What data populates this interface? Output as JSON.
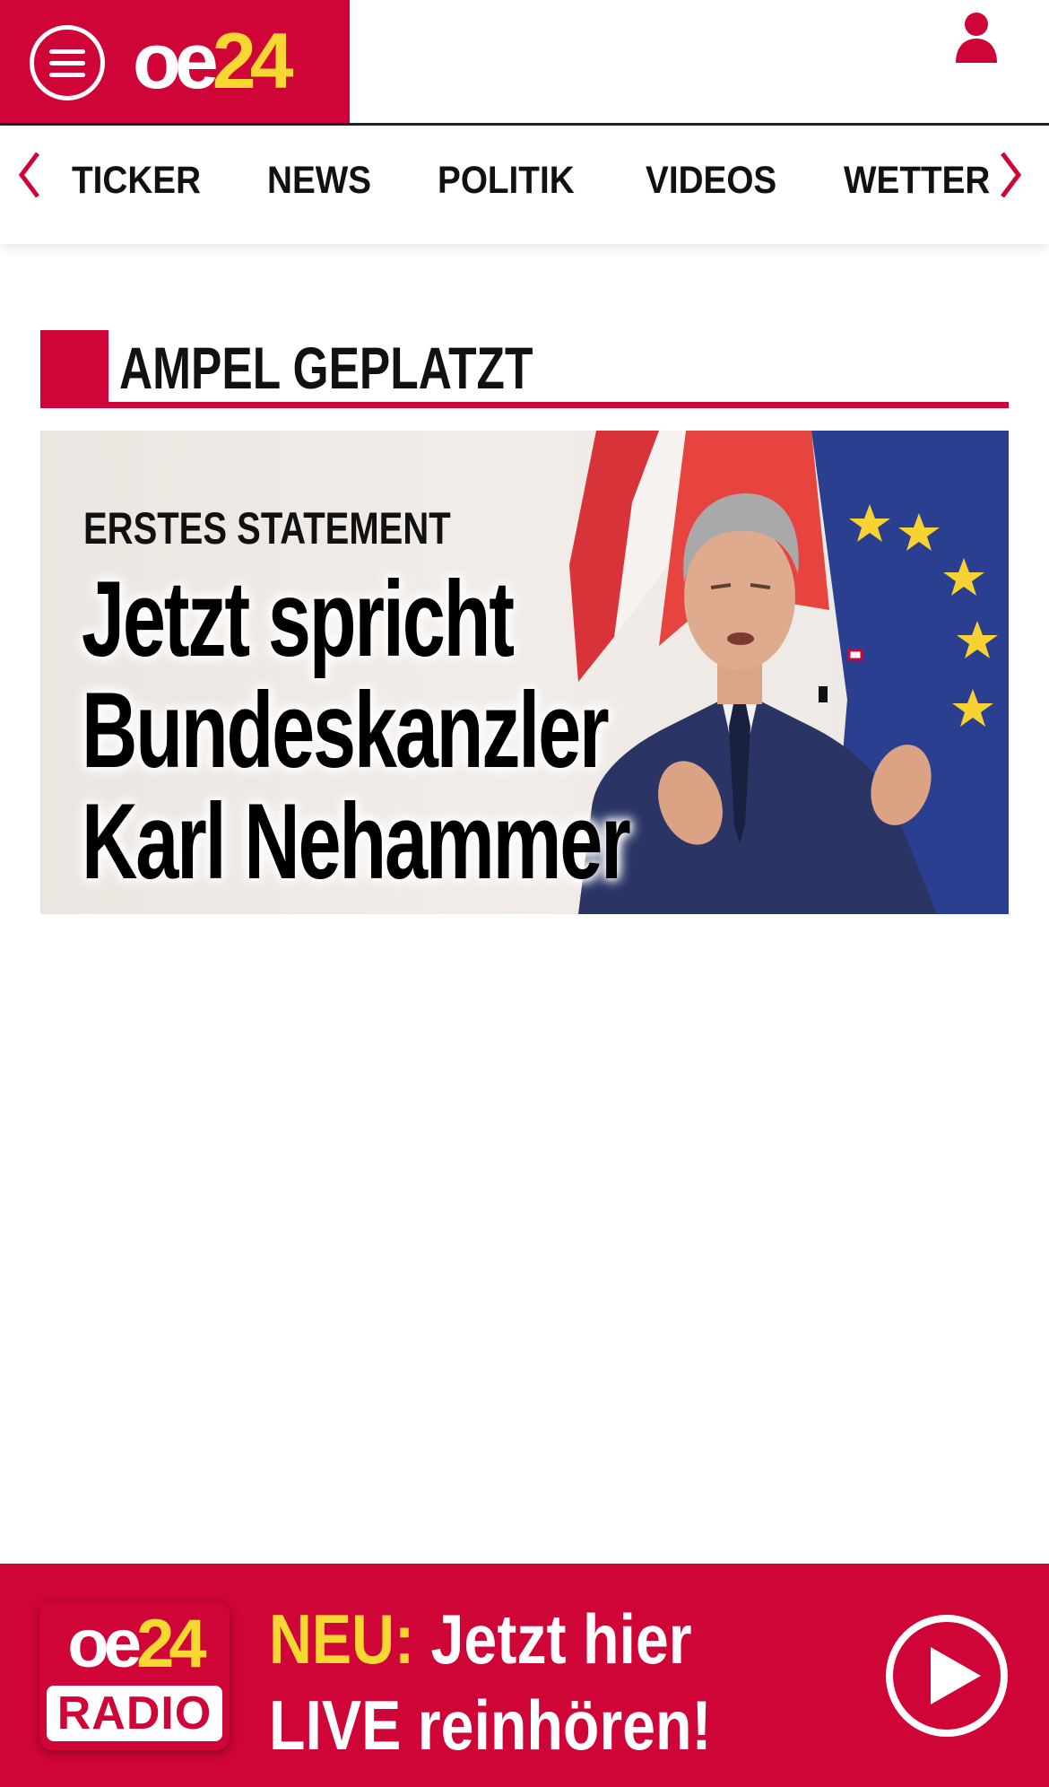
{
  "header": {
    "menu_icon": "hamburger-menu-icon",
    "logo": {
      "part1": "oe",
      "part2": "24"
    },
    "user_icon": "user-icon",
    "brand_color": "#cf0537",
    "accent_color": "#f7d732"
  },
  "nav": {
    "prev_icon": "chevron-left-icon",
    "next_icon": "chevron-right-icon",
    "items": [
      "TICKER",
      "NEWS",
      "POLITIK",
      "VIDEOS",
      "WETTER"
    ]
  },
  "section": {
    "title": "AMPEL GEPLATZT"
  },
  "teaser": {
    "kicker": "ERSTES STATEMENT",
    "headline_lines": [
      "Jetzt spricht",
      "Bundeskanzler",
      "Karl Nehammer"
    ],
    "image": "photo-of-speaking-chancellor-with-flags"
  },
  "radio": {
    "logo": {
      "part1": "oe",
      "part2": "24",
      "label": "RADIO"
    },
    "cta_prefix": "NEU:",
    "cta_line1": "Jetzt hier",
    "cta_line2": "LIVE reinhören!",
    "play_icon": "play-icon"
  }
}
